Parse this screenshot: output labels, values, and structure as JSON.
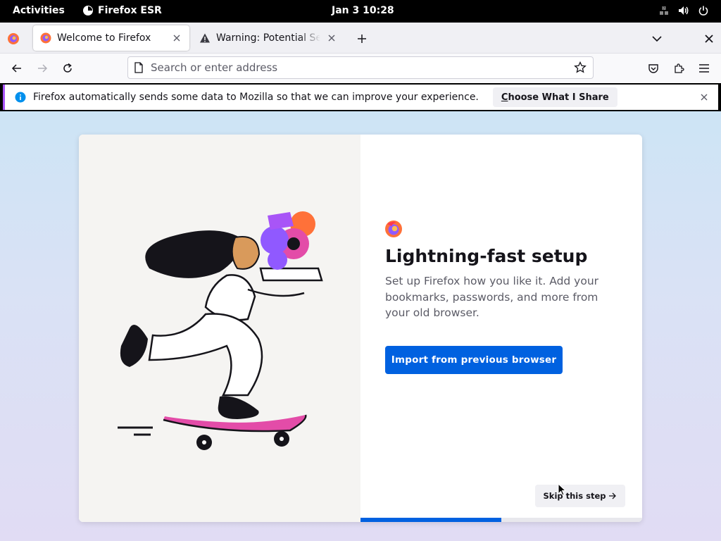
{
  "topbar": {
    "activities": "Activities",
    "app_name": "Firefox ESR",
    "clock": "Jan 3  10:28"
  },
  "tabs": [
    {
      "title": "Welcome to Firefox",
      "icon": "firefox-icon",
      "active": true
    },
    {
      "title": "Warning: Potential Security Risk Ahead",
      "icon": "warning-icon",
      "active": false
    }
  ],
  "urlbar": {
    "placeholder": "Search or enter address"
  },
  "notification": {
    "message": "Firefox automatically sends some data to Mozilla so that we can improve your experience.",
    "button_first": "C",
    "button_rest": "hoose What I Share"
  },
  "onboarding": {
    "heading": "Lightning-fast setup",
    "subtitle": "Set up Firefox how you like it. Add your bookmarks, passwords, and more from your old browser.",
    "primary_button": "Import from previous browser",
    "skip_button": "Skip this step",
    "progress_fraction": 0.5
  },
  "colors": {
    "accent": "#0061e0",
    "notification_stripe": "#a855f7"
  }
}
